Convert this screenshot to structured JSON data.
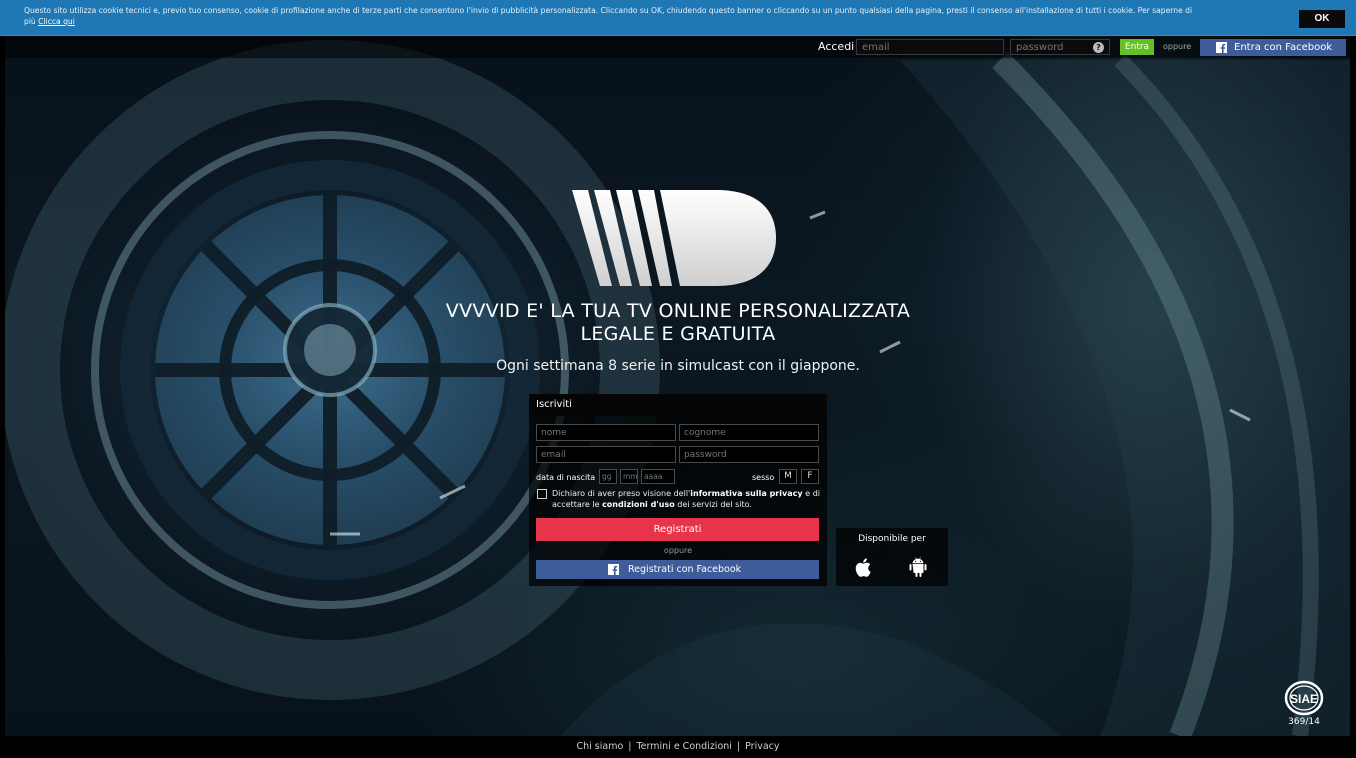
{
  "cookie_banner": {
    "text": "Questo sito utilizza cookie tecnici e, previo tuo consenso, cookie di profilazione anche di terze parti che consentono l'invio di pubblicità personalizzata. Cliccando su OK, chiudendo questo banner o cliccando su un punto qualsiasi della pagina, presti il consenso all'installazione di tutti i cookie. Per saperne di",
    "text_line2": "più",
    "link_label": "Clicca qui",
    "ok_label": "OK"
  },
  "login": {
    "label": "Accedi",
    "email_placeholder": "email",
    "password_placeholder": "password",
    "help_icon": "help-icon",
    "submit_label": "Entra",
    "or_label": "oppure",
    "facebook_label": "Entra con Facebook"
  },
  "hero": {
    "logo_icon": "vvvvid-logo",
    "headline_line1": "VVVVID E' LA TUA TV ONLINE PERSONALIZZATA",
    "headline_line2": "LEGALE E GRATUITA",
    "tagline": "Ogni settimana 8 serie in simulcast con il giappone."
  },
  "register": {
    "title": "Iscriviti",
    "name_placeholder": "nome",
    "surname_placeholder": "cognome",
    "email_placeholder": "email",
    "password_placeholder": "password",
    "dob_label": "data di nascita",
    "day_placeholder": "gg",
    "month_placeholder": "mm",
    "year_placeholder": "aaaa",
    "sex_label": "sesso",
    "sex_m": "M",
    "sex_f": "F",
    "privacy_prefix": "Dichiaro di aver preso visione dell'",
    "privacy_link": "informativa sulla privacy",
    "privacy_mid": " e di accettare le ",
    "terms_link": "condizioni d'uso",
    "privacy_suffix": " dei servizi del sito.",
    "submit_label": "Registrati",
    "or_label": "oppure",
    "facebook_label": "Registrati con Facebook"
  },
  "available": {
    "title": "Disponibile per",
    "platforms": [
      "apple-icon",
      "android-icon"
    ]
  },
  "siae": {
    "logo_text": "SIAE",
    "number": "369/14"
  },
  "footer": {
    "links": [
      "Chi siamo",
      "Termini e Condizioni",
      "Privacy"
    ],
    "separator": "|"
  },
  "colors": {
    "cookie_bar": "#1f78b4",
    "login_green": "#65c123",
    "facebook_blue": "#3e5c9a",
    "register_red": "#e8344a"
  }
}
